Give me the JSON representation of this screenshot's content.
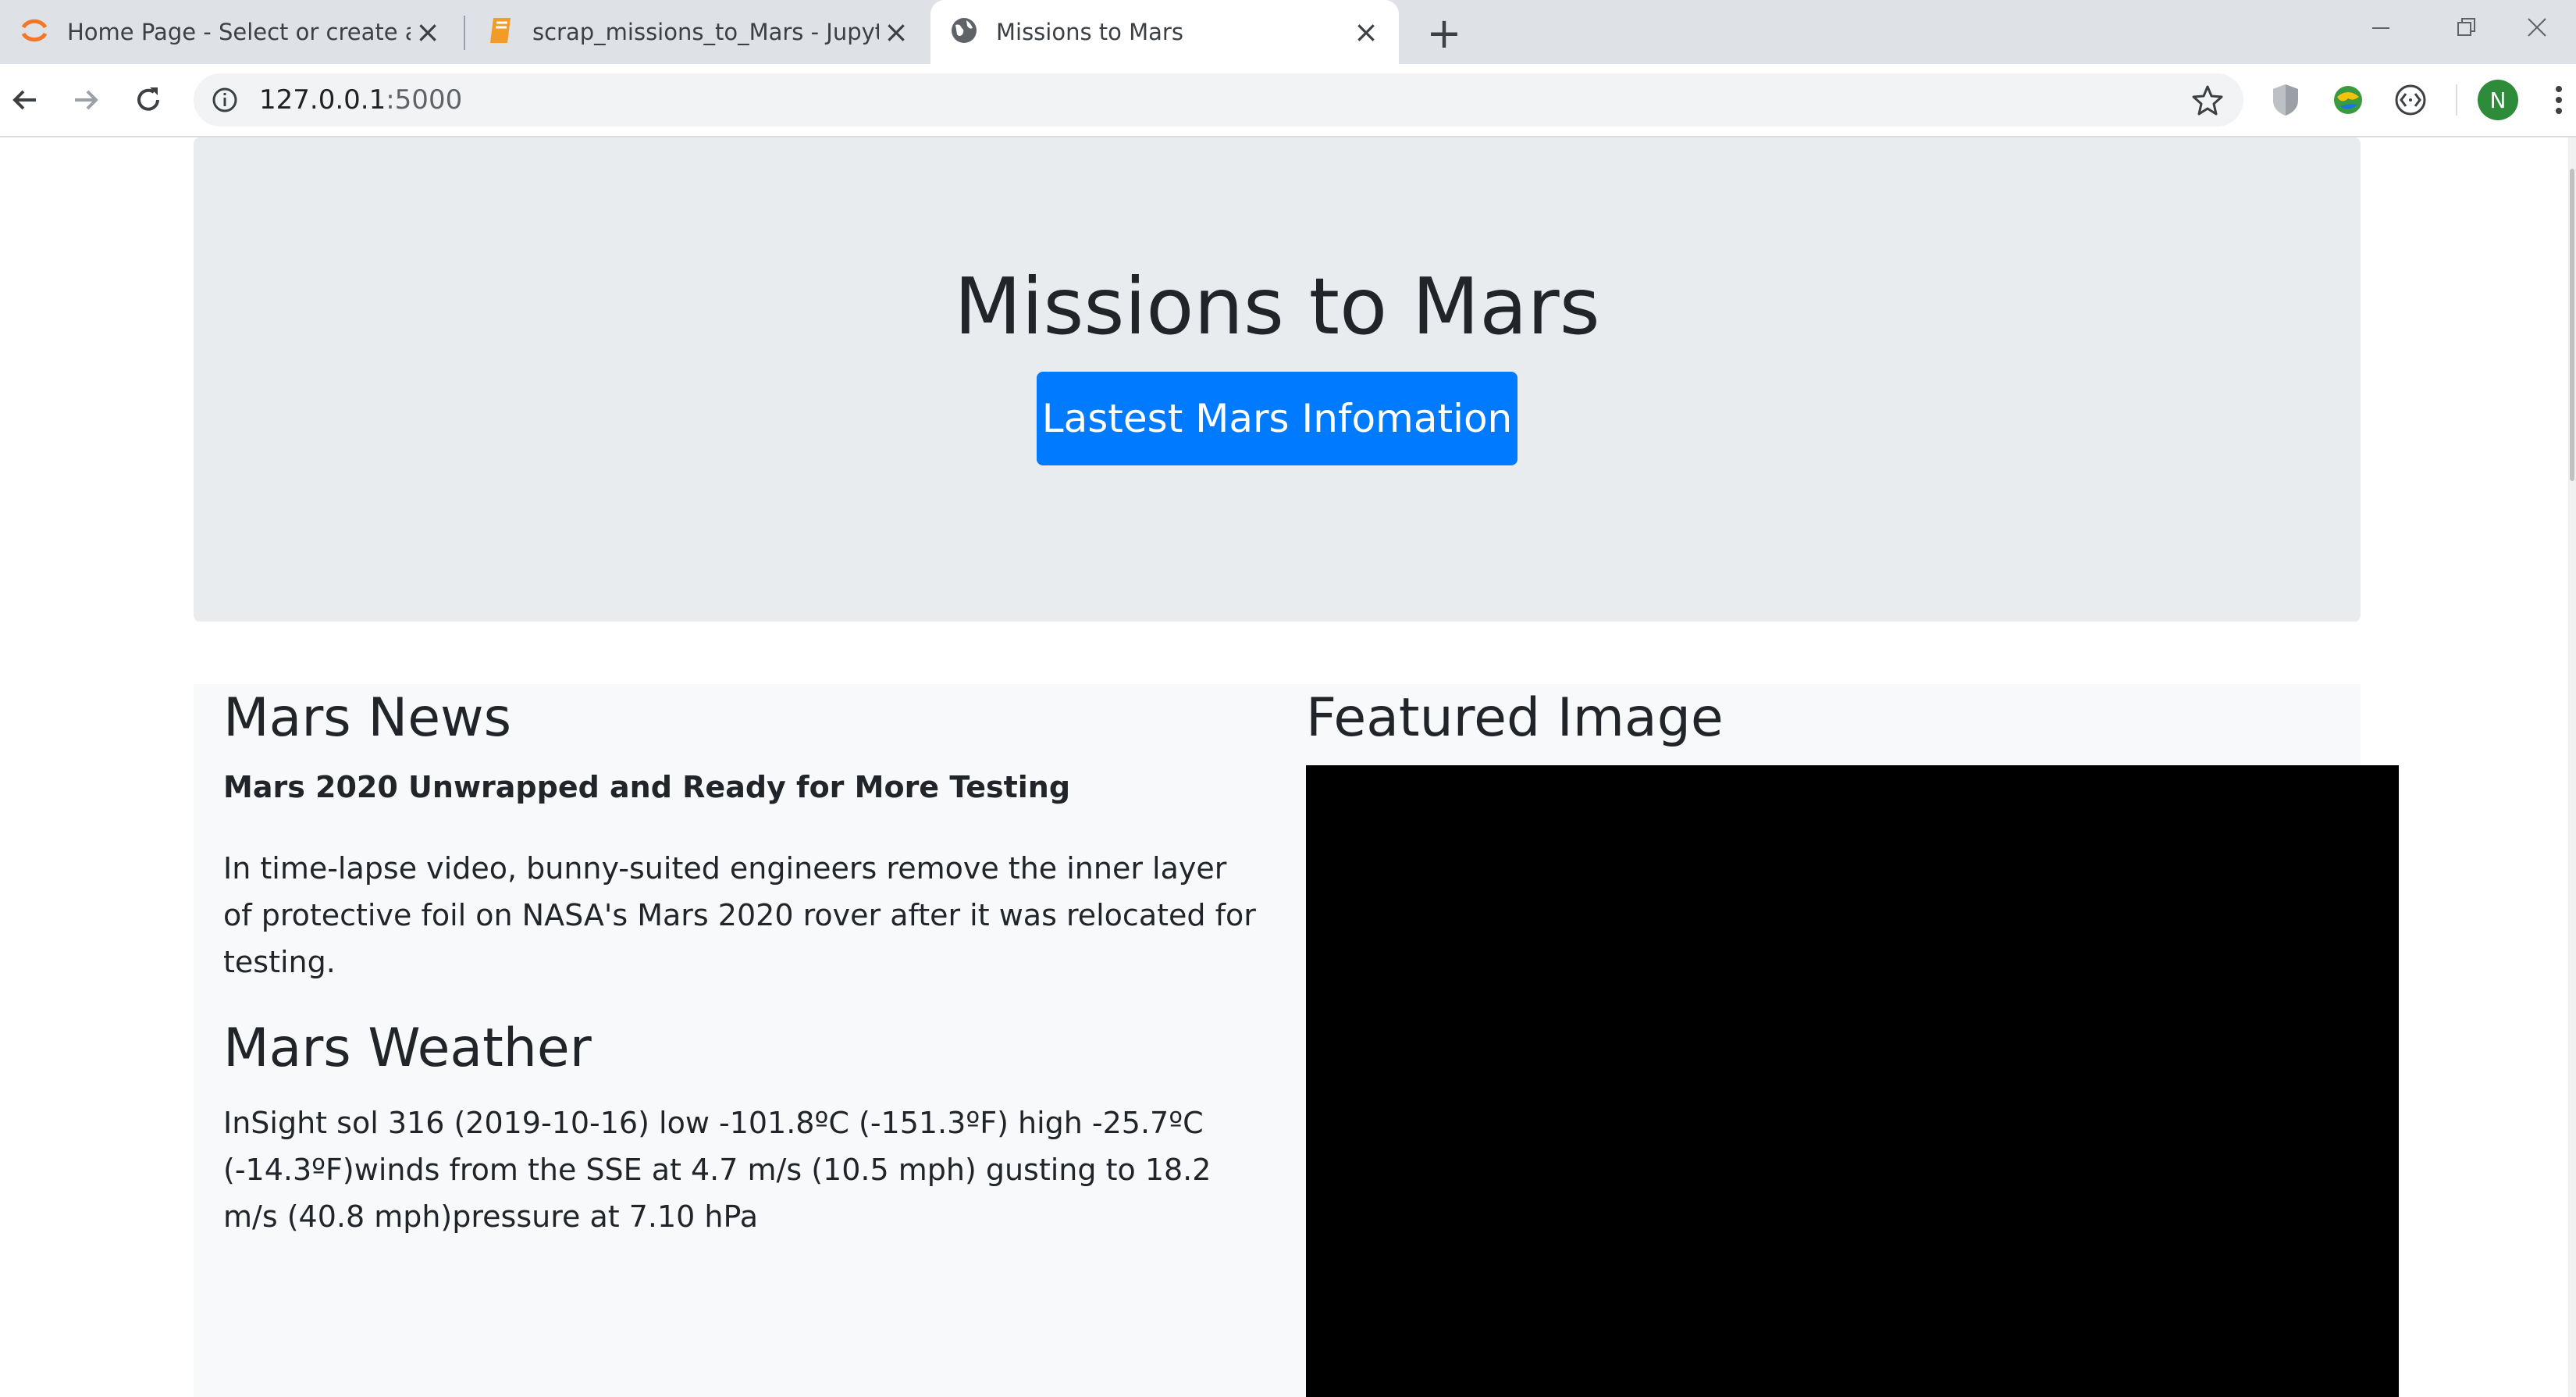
{
  "browser": {
    "tabs": [
      {
        "title": "Home Page - Select or create a n",
        "icon": "jupyter-icon",
        "active": false
      },
      {
        "title": "scrap_missions_to_Mars - Jupyte",
        "icon": "notebook-icon",
        "active": false
      },
      {
        "title": "Missions to Mars",
        "icon": "globe-icon",
        "active": true
      }
    ],
    "address": {
      "host": "127.0.0.1",
      "port": ":5000"
    },
    "profile_initial": "N",
    "colors": {
      "tabbar": "#dee1e6",
      "avatar": "#2e8b3a"
    }
  },
  "page": {
    "jumbotron": {
      "title": "Missions to Mars",
      "button_label": "Lastest Mars Infomation"
    },
    "news": {
      "heading": "Mars News",
      "title": "Mars 2020 Unwrapped and Ready for More Testing",
      "paragraph": "In time-lapse video, bunny-suited engineers remove the inner layer of protective foil on NASA's Mars 2020 rover after it was relocated for testing."
    },
    "weather": {
      "heading": "Mars Weather",
      "text": "InSight sol 316 (2019-10-16) low -101.8ºC (-151.3ºF) high -25.7ºC (-14.3ºF)winds from the SSE at 4.7 m/s (10.5 mph) gusting to 18.2 m/s (40.8 mph)pressure at 7.10 hPa"
    },
    "featured": {
      "heading": "Featured Image"
    },
    "colors": {
      "primary_button": "#007bff",
      "jumbotron_bg": "#e9ecef",
      "content_bg": "#f8f9fa"
    }
  }
}
